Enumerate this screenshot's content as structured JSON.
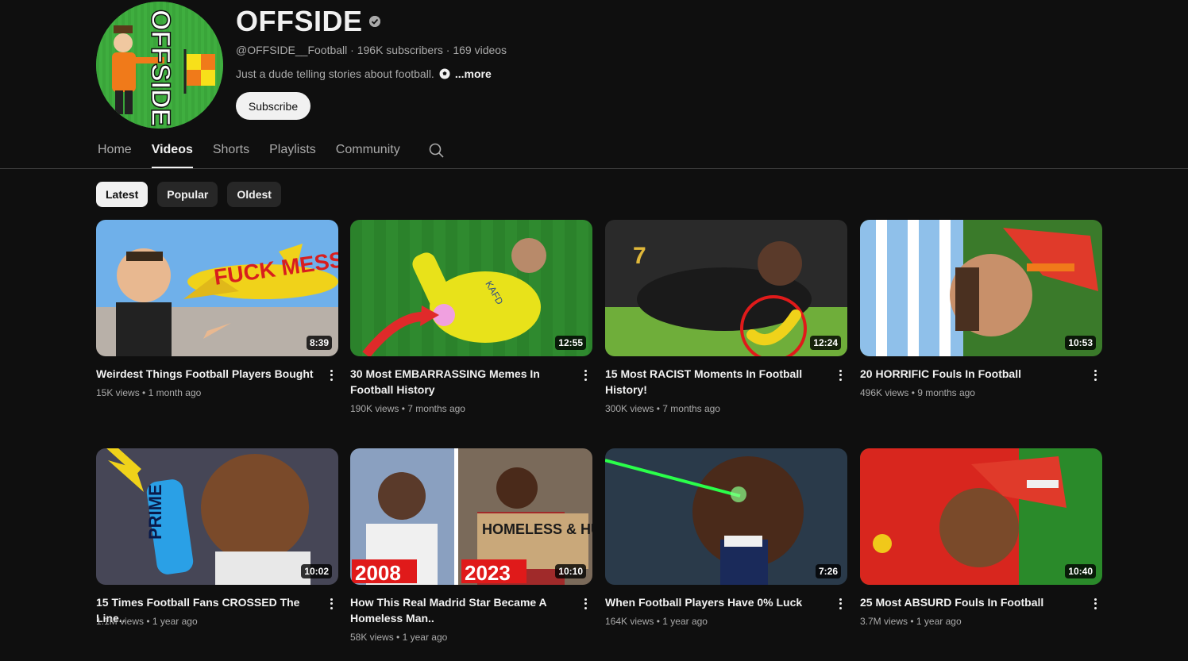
{
  "channel": {
    "name": "OFFSIDE",
    "handle": "@OFFSIDE__Football",
    "subscribers": "196K subscribers",
    "video_count": "169 videos",
    "description": "Just a dude telling stories about football.",
    "more_label": "...more",
    "subscribe_label": "Subscribe",
    "avatar_text": "OFFSIDE"
  },
  "tabs": [
    {
      "label": "Home"
    },
    {
      "label": "Videos"
    },
    {
      "label": "Shorts"
    },
    {
      "label": "Playlists"
    },
    {
      "label": "Community"
    }
  ],
  "active_tab": "Videos",
  "chips": [
    {
      "label": "Latest"
    },
    {
      "label": "Popular"
    },
    {
      "label": "Oldest"
    }
  ],
  "videos": [
    {
      "title": "Weirdest Things Football Players Bought",
      "views": "15K views",
      "age": "1 month ago",
      "duration": "8:39",
      "thumb_text": "FUCK MESSI",
      "thumb_colors": [
        "#5aa0e6",
        "#e8c21a"
      ]
    },
    {
      "title": "30 Most EMBARRASSING Memes In Football History",
      "views": "190K views",
      "age": "7 months ago",
      "duration": "12:55",
      "thumb_text": "KAFD",
      "thumb_colors": [
        "#2f8a2f",
        "#e6e21a"
      ]
    },
    {
      "title": "15 Most RACIST Moments In Football History!",
      "views": "300K views",
      "age": "7 months ago",
      "duration": "12:24",
      "thumb_text": "",
      "thumb_colors": [
        "#2a2a2a",
        "#6fae3a"
      ]
    },
    {
      "title": "20 HORRIFIC Fouls In Football",
      "views": "496K views",
      "age": "9 months ago",
      "duration": "10:53",
      "thumb_text": "",
      "thumb_colors": [
        "#7fb6e6",
        "#e03a2a"
      ]
    },
    {
      "title": "15 Times Football Fans CROSSED The Line..",
      "views": "1.1M views",
      "age": "1 year ago",
      "duration": "10:02",
      "thumb_text": "PRIME",
      "thumb_colors": [
        "#3a3a4a",
        "#2aa0e6"
      ]
    },
    {
      "title": "How This Real Madrid Star Became A Homeless Man..",
      "views": "58K views",
      "age": "1 year ago",
      "duration": "10:10",
      "thumb_text": "HOMELESS & HUNGRY",
      "thumb_years": [
        "2008",
        "2023"
      ],
      "thumb_colors": [
        "#8aa0c0",
        "#c9a87a"
      ]
    },
    {
      "title": "When Football Players Have 0% Luck",
      "views": "164K views",
      "age": "1 year ago",
      "duration": "7:26",
      "thumb_text": "",
      "thumb_colors": [
        "#1a2a3a",
        "#2aff4a"
      ]
    },
    {
      "title": "25 Most ABSURD Fouls In Football",
      "views": "3.7M views",
      "age": "1 year ago",
      "duration": "10:40",
      "thumb_text": "",
      "thumb_colors": [
        "#d8261e",
        "#2a8a2a"
      ]
    }
  ]
}
